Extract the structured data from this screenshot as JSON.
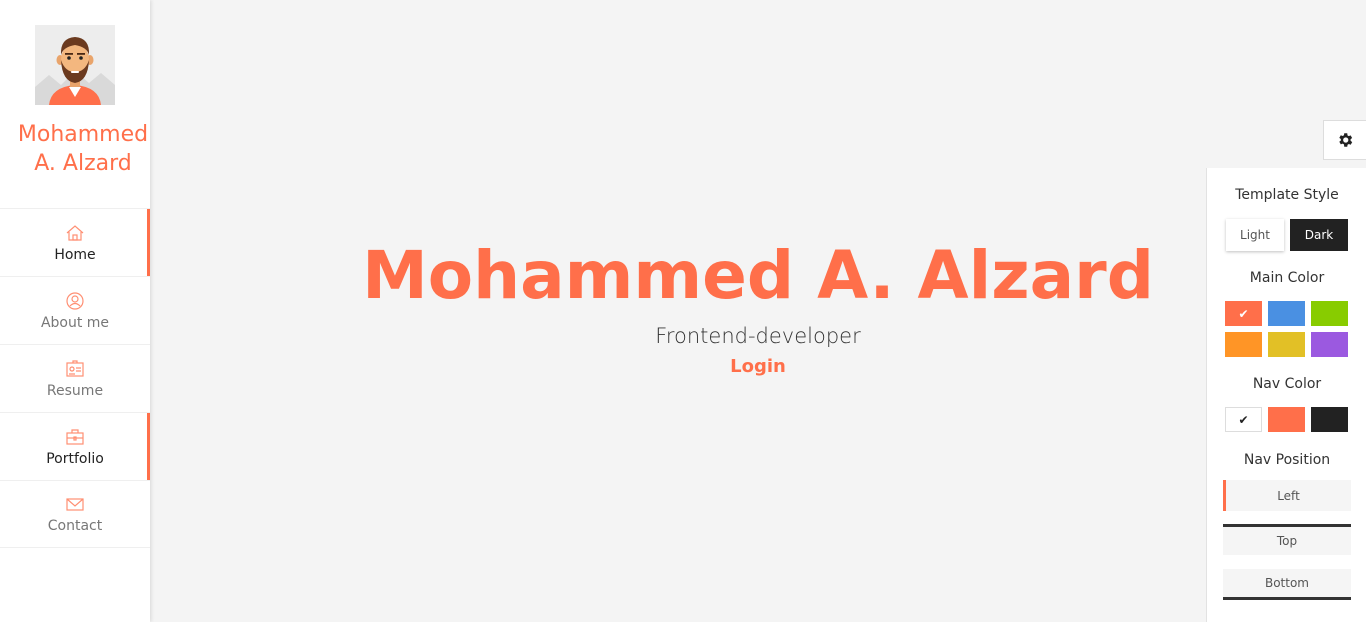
{
  "sidebar": {
    "name_line1": "Mohammed",
    "name_line2": "A. Alzard",
    "avatar_icon": "avatar-illustration-icon",
    "items": [
      {
        "label": "Home",
        "icon": "home-icon",
        "active": true
      },
      {
        "label": "About me",
        "icon": "user-icon",
        "active": false
      },
      {
        "label": "Resume",
        "icon": "resume-icon",
        "active": false
      },
      {
        "label": "Portfolio",
        "icon": "briefcase-icon",
        "active": true
      },
      {
        "label": "Contact",
        "icon": "envelope-icon",
        "active": false
      }
    ]
  },
  "hero": {
    "title": "Mohammed A. Alzard",
    "subtitle": "Frontend-developer",
    "login": "Login"
  },
  "settings": {
    "toggle_icon": "gear-icon",
    "template_style": {
      "heading": "Template Style",
      "options": [
        "Light",
        "Dark"
      ],
      "selected": "Light"
    },
    "main_color": {
      "heading": "Main Color",
      "swatches": [
        "#ff6f4a",
        "#4a90e2",
        "#88cc00",
        "#ff9526",
        "#e2c026",
        "#9b59e0"
      ],
      "selected": "#ff6f4a"
    },
    "nav_color": {
      "heading": "Nav Color",
      "swatches": [
        "#ffffff",
        "#ff6f4a",
        "#222222"
      ],
      "selected": "#ffffff"
    },
    "nav_position": {
      "heading": "Nav Position",
      "options": [
        "Left",
        "Top",
        "Bottom"
      ],
      "selected": "Left"
    }
  },
  "colors": {
    "accent": "#ff6f4a",
    "background": "#f4f4f4"
  }
}
